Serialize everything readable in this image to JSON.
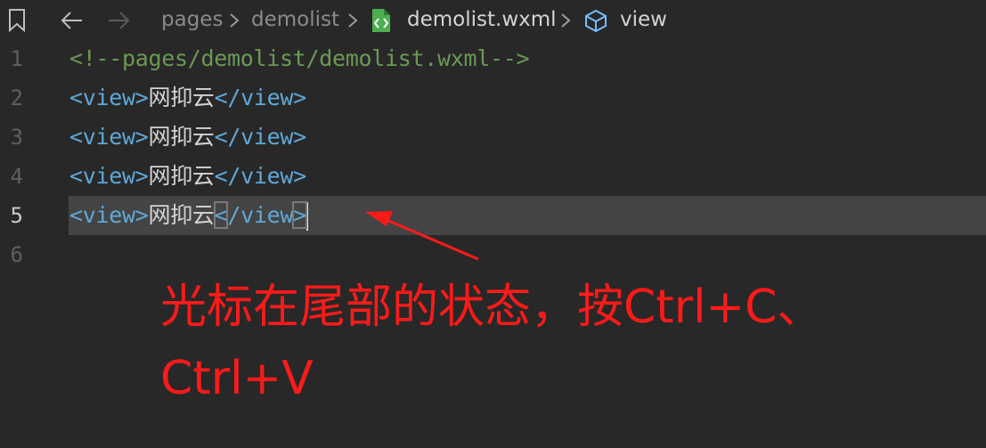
{
  "toolbar": {
    "bookmark_icon": "bookmark-icon",
    "back_icon": "arrow-left-icon",
    "forward_icon": "arrow-right-icon"
  },
  "breadcrumb": {
    "segments": [
      "pages",
      "demolist",
      "demolist.wxml",
      "view"
    ],
    "file_icon": "wxml-file-icon",
    "symbol_icon": "cube-symbol-icon",
    "separator_icon": "chevron-right-icon"
  },
  "editor": {
    "current_line": 5,
    "lines": [
      {
        "number": "1",
        "comment": "<!--pages/demolist/demolist.wxml-->"
      },
      {
        "number": "2",
        "open_tag": "<view>",
        "text": "网抑云",
        "close_tag": "</view>"
      },
      {
        "number": "3",
        "open_tag": "<view>",
        "text": "网抑云",
        "close_tag": "</view>"
      },
      {
        "number": "4",
        "open_tag": "<view>",
        "text": "网抑云",
        "close_tag": "</view>"
      },
      {
        "number": "5",
        "open_tag": "<view>",
        "text": "网抑云",
        "close_lt": "<",
        "close_mid": "/view",
        "close_gt": ">"
      },
      {
        "number": "6"
      }
    ]
  },
  "annotation": {
    "line1": "光标在尾部的状态，按Ctrl+C、",
    "line2": "Ctrl+V",
    "color": "#ff1a1a"
  },
  "colors": {
    "background": "#282828",
    "current_line": "#444444",
    "tag": "#5fa8d8",
    "comment": "#6a9955",
    "text": "#d4d4d4",
    "annotation": "#ff1a1a"
  }
}
